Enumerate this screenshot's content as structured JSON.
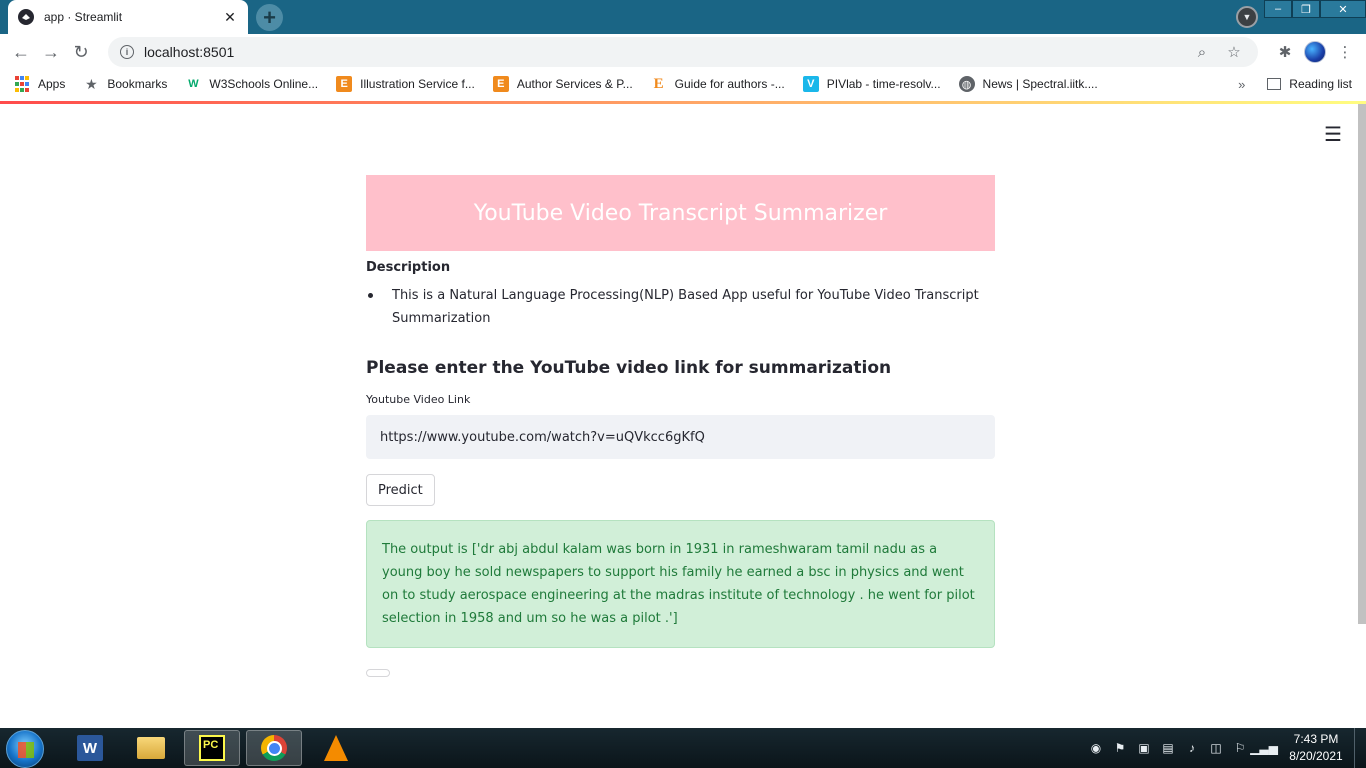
{
  "browser": {
    "tab_title": "app · Streamlit",
    "tab_close": "✕",
    "new_tab": "+",
    "url": "localhost:8501",
    "window_controls": {
      "minimize": "–",
      "maximize": "❐",
      "close": "✕"
    },
    "nav": {
      "back": "←",
      "forward": "→",
      "reload": "↻"
    },
    "toolbar_icons": {
      "zoom": "⌕",
      "star": "☆",
      "extensions": "✱",
      "menu": "⋮"
    }
  },
  "bookmarks": {
    "items": [
      {
        "label": "Apps",
        "icon": "apps-grid-icon",
        "color": "#ea4335"
      },
      {
        "label": "Bookmarks",
        "icon": "star-icon",
        "color": "#5f6368"
      },
      {
        "label": "W3Schools Online...",
        "icon": "w3schools-icon",
        "color": "#04aa6d"
      },
      {
        "label": "Illustration Service f...",
        "icon": "elsevier-icon",
        "color": "#f08a1d"
      },
      {
        "label": "Author Services & P...",
        "icon": "elsevier-icon",
        "color": "#f08a1d"
      },
      {
        "label": "Guide for authors -...",
        "icon": "elsevier-e-icon",
        "color": "#f08a1d"
      },
      {
        "label": "PIVlab - time-resolv...",
        "icon": "vimeo-icon",
        "color": "#1ab7ea"
      },
      {
        "label": "News | Spectral.iitk....",
        "icon": "globe-icon",
        "color": "#5f6368"
      }
    ],
    "overflow": "»",
    "reading_list": "Reading list"
  },
  "app": {
    "banner_title": "YouTube Video Transcript Summarizer",
    "banner_color": "#ffc0cb",
    "description_heading": "Description",
    "description_items": [
      "This is a Natural Language Processing(NLP) Based App useful for YouTube Video Transcript Summarization"
    ],
    "subheader": "Please enter the YouTube video link for summarization",
    "input_label": "Youtube Video Link",
    "input_value": "https://www.youtube.com/watch?v=uQVkcc6gKfQ",
    "predict_button": "Predict",
    "output_text": "The output is ['dr abj abdul kalam was born in 1931 in rameshwaram tamil nadu as a young boy he sold newspapers to support his family he earned a bsc in physics and went on to study aerospace engineering at the madras institute of technology . he went for pilot selection in 1958 and um so he was a pilot .']",
    "menu_icon": "☰"
  },
  "taskbar": {
    "apps": [
      "word",
      "file-explorer",
      "pycharm",
      "chrome",
      "vlc"
    ],
    "word_label": "W",
    "pycharm_label": "PC",
    "time": "7:43 PM",
    "date": "8/20/2021"
  }
}
